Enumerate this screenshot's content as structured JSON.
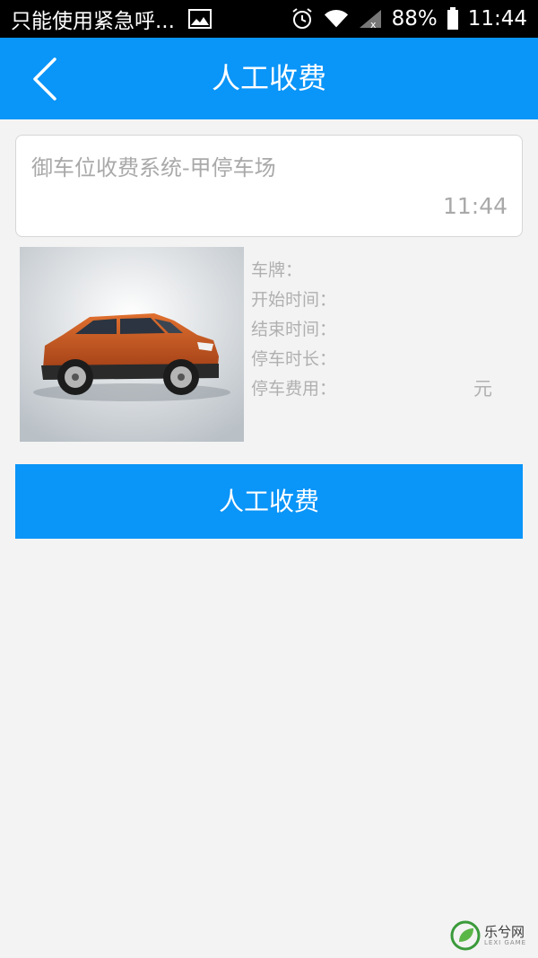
{
  "status_bar": {
    "notification_text": "只能使用紧急呼...",
    "battery_percent": "88%",
    "time": "11:44",
    "icons": [
      "image-icon",
      "alarm-icon",
      "wifi-icon",
      "signal-icon",
      "battery-icon"
    ]
  },
  "app_bar": {
    "title": "人工收费",
    "back_icon": "chevron-left-icon"
  },
  "message": {
    "title": "御车位收费系统-甲停车场",
    "time": "11:44"
  },
  "car_info": {
    "plate_label": "车牌：",
    "start_time_label": "开始时间：",
    "end_time_label": "结束时间：",
    "duration_label": "停车时长：",
    "fee_label": "停车费用：",
    "fee_unit": "元"
  },
  "actions": {
    "charge_label": "人工收费"
  },
  "watermark": {
    "text": "乐兮网",
    "subtext": "LEXI GAME"
  },
  "colors": {
    "primary": "#0a95f8",
    "background": "#f3f3f3",
    "muted_text": "#a9a9a9",
    "car": "#c4531f"
  }
}
